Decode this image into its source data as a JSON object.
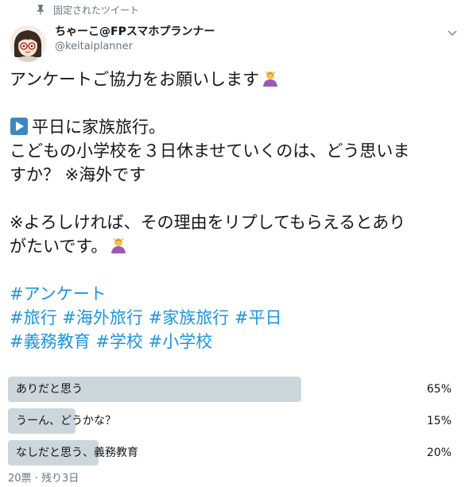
{
  "pinned": {
    "icon": "pin-icon",
    "label": "固定されたツイート"
  },
  "author": {
    "name": "ちゃーこ@FPスマホプランナー",
    "handle": "@keitaiplanner"
  },
  "tweet": {
    "line1": "アンケートご協力をお願いします",
    "line2": "平日に家族旅行。",
    "line3": "こどもの小学校を３日休ませていくのは、どう思いま",
    "line4": "すか？ ※海外です",
    "line5": "※よろしければ、その理由をリプしてもらえるとあり",
    "line6": "がたいです。",
    "hashtags_line1": [
      "#アンケート"
    ],
    "hashtags_line2": [
      "#旅行",
      "#海外旅行",
      "#家族旅行",
      "#平日"
    ],
    "hashtags_line3": [
      "#義務教育",
      "#学校",
      "#小学校"
    ]
  },
  "poll": {
    "options": [
      {
        "label": "ありだと思う",
        "percent_text": "65%",
        "percent": 65
      },
      {
        "label": "うーん、どうかな？",
        "percent_text": "15%",
        "percent": 15
      },
      {
        "label": "なしだと思う、義務教育",
        "percent_text": "20%",
        "percent": 20
      }
    ],
    "meta": "20票 · 残り3日",
    "bar_color": "#ccd6dd"
  },
  "colors": {
    "hashtag": "#1b95e0",
    "secondary_text": "#657786"
  }
}
